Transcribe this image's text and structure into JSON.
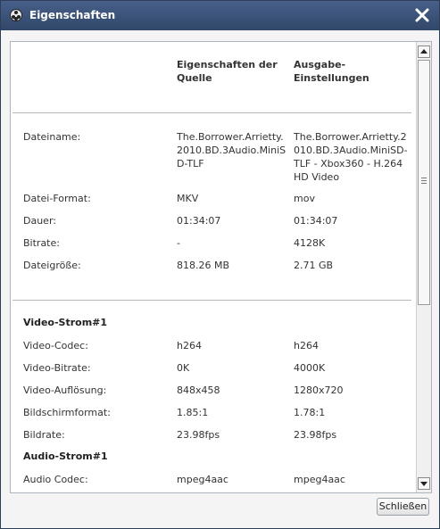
{
  "window": {
    "title": "Eigenschaften",
    "close_icon": "close-icon",
    "app_icon": "film-reel-icon"
  },
  "columns": {
    "source": "Eigenschaften der Quelle",
    "output": "Ausgabe-Einstellungen"
  },
  "general": [
    {
      "label": "Dateiname:",
      "source": "The.Borrower.Arrietty.2010.BD.3Audio.MiniSD-TLF",
      "output": "The.Borrower.Arrietty.2010.BD.3Audio.MiniSD-TLF - Xbox360 - H.264 HD Video"
    },
    {
      "label": "Datei-Format:",
      "source": "MKV",
      "output": "mov"
    },
    {
      "label": "Dauer:",
      "source": "01:34:07",
      "output": "01:34:07"
    },
    {
      "label": "Bitrate:",
      "source": "-",
      "output": "4128K"
    },
    {
      "label": "Dateigröße:",
      "source": "818.26 MB",
      "output": "2.71 GB"
    }
  ],
  "video": {
    "title": "Video-Strom#1",
    "rows": [
      {
        "label": "Video-Codec:",
        "source": "h264",
        "output": "h264"
      },
      {
        "label": "Video-Bitrate:",
        "source": "0K",
        "output": "4000K"
      },
      {
        "label": "Video-Auflösung:",
        "source": "848x458",
        "output": "1280x720"
      },
      {
        "label": "Bildschirmformat:",
        "source": "1.85:1",
        "output": "1.78:1"
      },
      {
        "label": "Bildrate:",
        "source": "23.98fps",
        "output": "23.98fps"
      }
    ]
  },
  "audio": {
    "title": "Audio-Strom#1",
    "rows": [
      {
        "label": "Audio Codec:",
        "source": "mpeg4aac",
        "output": "mpeg4aac"
      }
    ]
  },
  "footer": {
    "close_label": "Schließen"
  }
}
